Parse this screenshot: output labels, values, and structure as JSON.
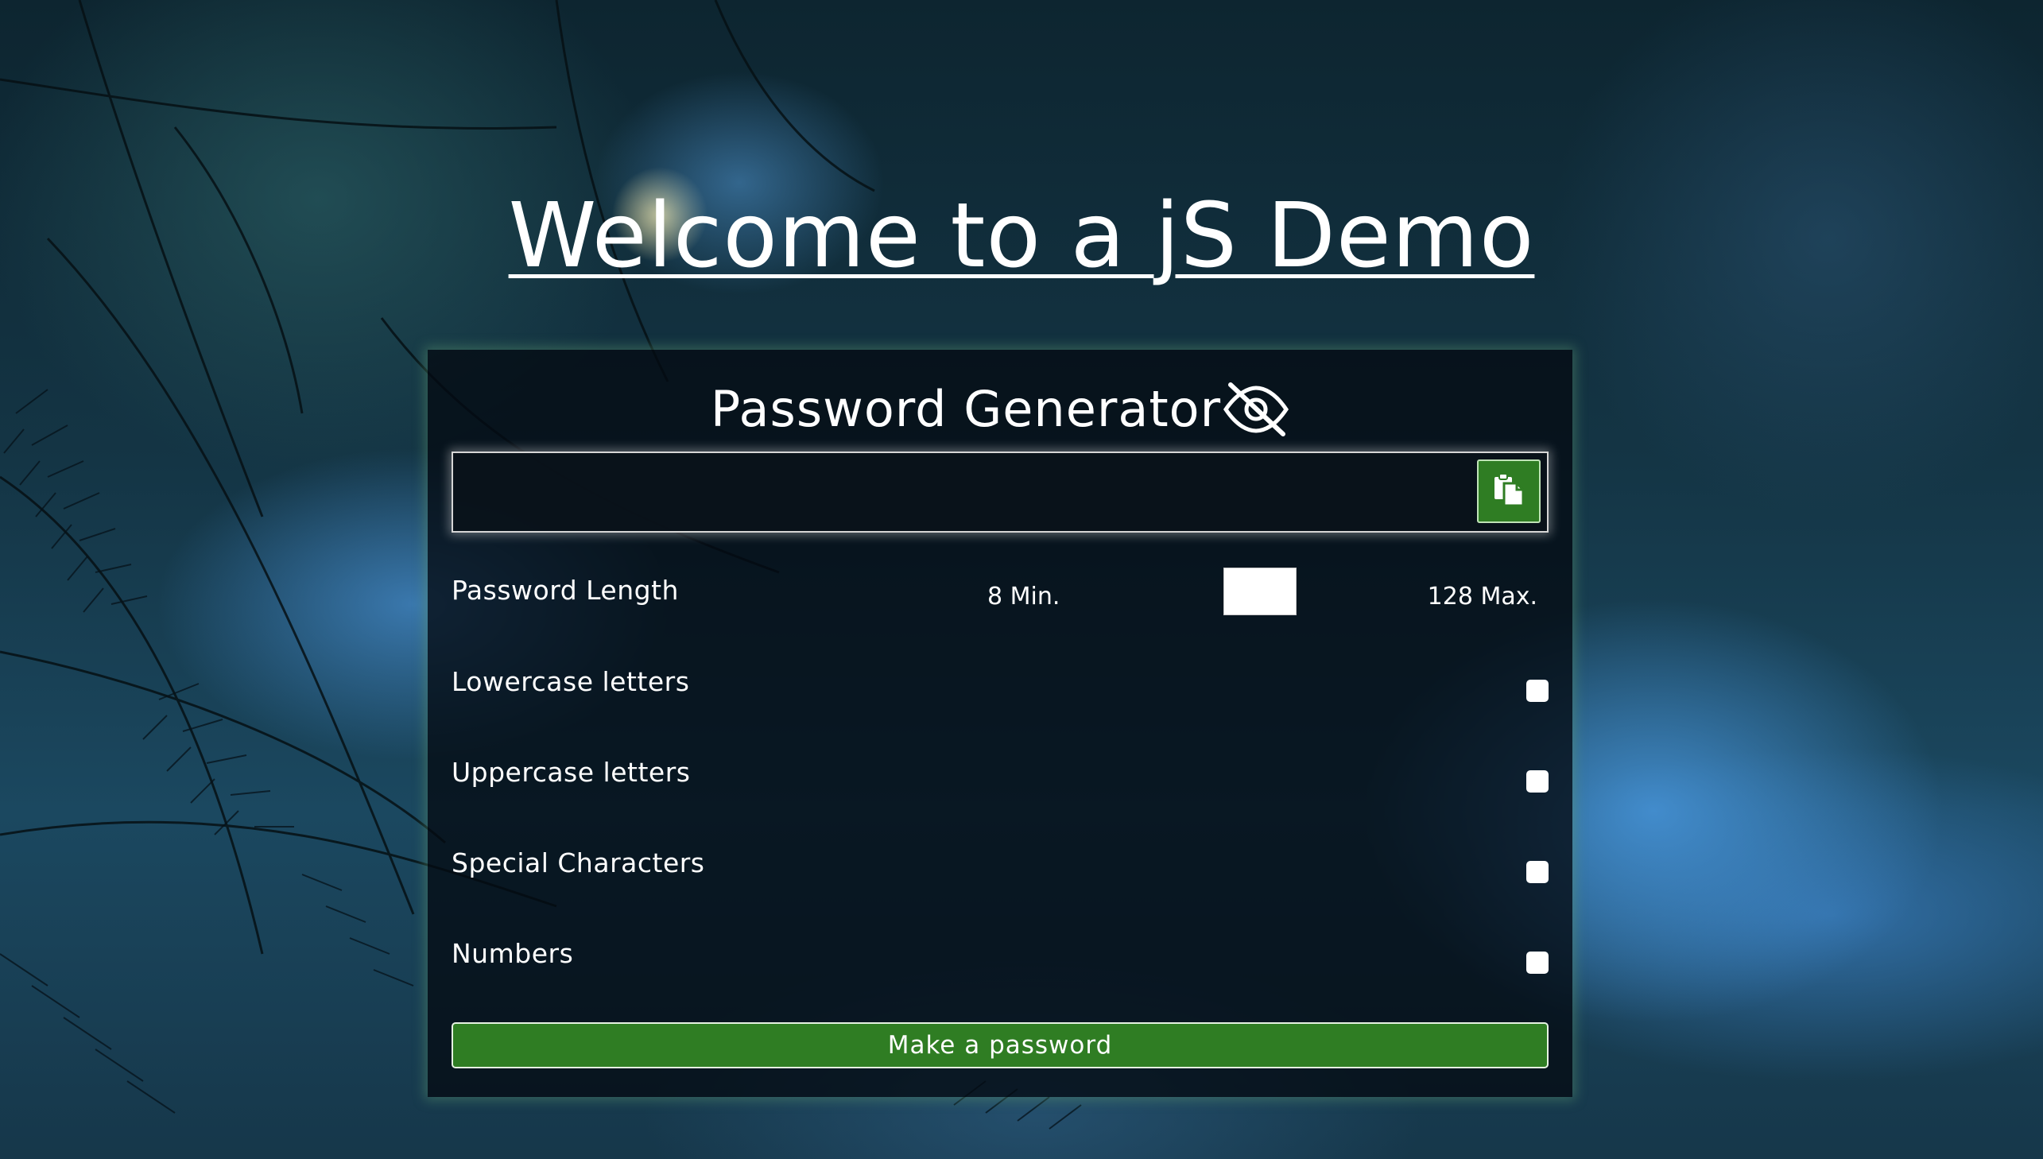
{
  "header": {
    "title": "Welcome to a jS Demo"
  },
  "card": {
    "title": "Password Generator",
    "visibility_icon": "eye-slash-icon",
    "output": {
      "value": "",
      "placeholder": ""
    },
    "copy_icon": "clipboard-copy-icon",
    "length": {
      "label": "Password Length",
      "min_label": "8 Min.",
      "max_label": "128 Max.",
      "value": ""
    },
    "options": [
      {
        "label": "Lowercase letters",
        "checked": false
      },
      {
        "label": "Uppercase letters",
        "checked": false
      },
      {
        "label": "Special Characters",
        "checked": false
      },
      {
        "label": "Numbers",
        "checked": false
      }
    ],
    "generate_label": "Make a password"
  },
  "colors": {
    "accent_green": "#2f7d23",
    "card_background": "#040a12",
    "text": "#ffffff"
  }
}
